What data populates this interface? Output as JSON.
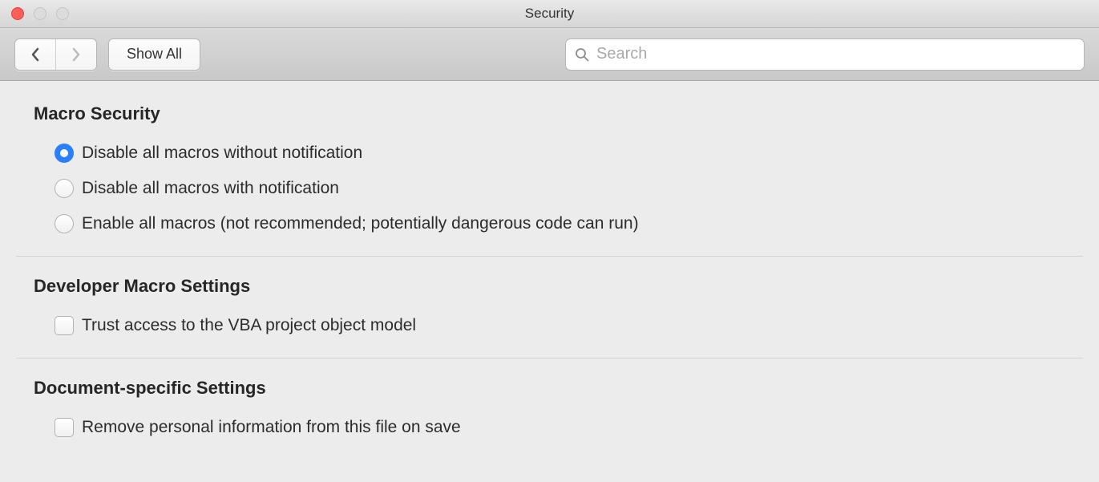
{
  "window": {
    "title": "Security"
  },
  "toolbar": {
    "show_all_label": "Show All",
    "search_placeholder": "Search"
  },
  "sections": {
    "macro_security": {
      "title": "Macro Security",
      "options": [
        "Disable all macros without notification",
        "Disable all macros with notification",
        "Enable all macros (not recommended; potentially dangerous code can run)"
      ],
      "selected_index": 0
    },
    "developer_macro": {
      "title": "Developer Macro Settings",
      "options": [
        "Trust access to the VBA project object model"
      ]
    },
    "document_specific": {
      "title": "Document-specific Settings",
      "options": [
        "Remove personal information from this file on save"
      ]
    }
  }
}
